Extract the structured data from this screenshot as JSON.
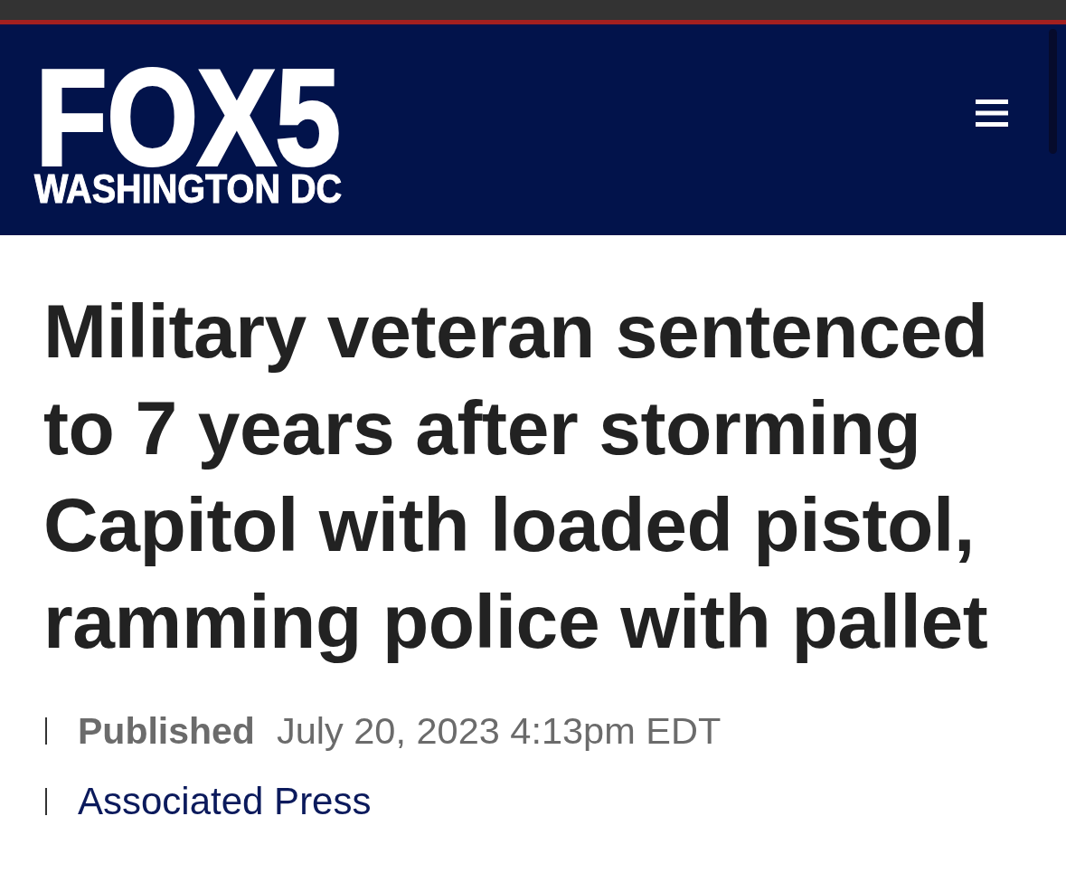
{
  "header": {
    "logo": {
      "wordmark": "FOX5",
      "tagline": "WASHINGTON DC"
    }
  },
  "article": {
    "headline": "Military veteran sentenced to 7 years after storming Capitol with loaded pistol, ramming police with pallet",
    "meta": [
      {
        "kind": "published",
        "label": "Published",
        "value": "July 20, 2023 4:13pm EDT"
      },
      {
        "kind": "author",
        "value": "Associated Press"
      }
    ]
  }
}
